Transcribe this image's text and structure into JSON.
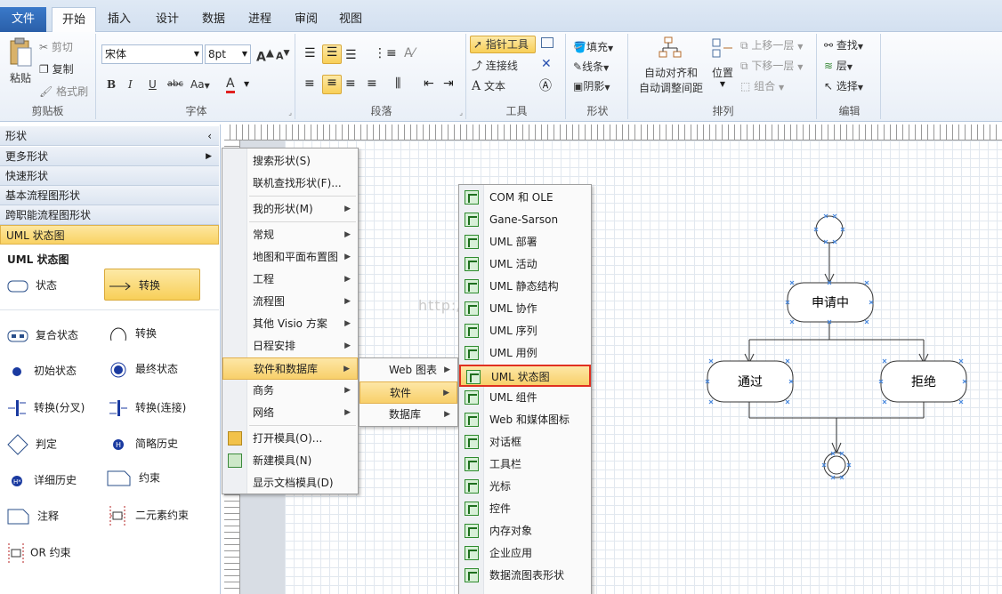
{
  "tabs": [
    "文件",
    "开始",
    "插入",
    "设计",
    "数据",
    "进程",
    "审阅",
    "视图"
  ],
  "ribbon": {
    "clipboard": {
      "paste": "粘贴",
      "cut": "剪切",
      "copy": "复制",
      "format_painter": "格式刷",
      "label": "剪贴板"
    },
    "font": {
      "family": "宋体",
      "size": "8pt",
      "bold": "B",
      "italic": "I",
      "underline": "U",
      "strike": "abc",
      "case": "Aa",
      "color": "A",
      "grow": "A",
      "shrink": "A",
      "label": "字体"
    },
    "paragraph": {
      "label": "段落"
    },
    "tools": {
      "pointer": "指针工具",
      "connector": "连接线",
      "text": "文本",
      "label": "工具"
    },
    "shape": {
      "fill": "填充",
      "line": "线条",
      "shadow": "阴影",
      "label": "形状"
    },
    "arrange": {
      "auto_align": "自动对齐和",
      "auto_space": "自动调整间距",
      "position": "位置",
      "bring_forward": "上移一层",
      "send_backward": "下移一层",
      "group": "组合",
      "label": "排列"
    },
    "editing": {
      "find": "查找",
      "layer": "层",
      "select": "选择",
      "label": "编辑"
    }
  },
  "shapes_panel": {
    "title": "形状",
    "sections": [
      "更多形状",
      "快速形状",
      "基本流程图形状",
      "跨职能流程图形状",
      "UML 状态图"
    ],
    "stencil_title": "UML 状态图",
    "stencils": [
      {
        "label": "状态",
        "icon": "state-icon"
      },
      {
        "label": "转换",
        "icon": "transition-icon"
      },
      {
        "label": "复合状态",
        "icon": "composite-state-icon"
      },
      {
        "label": "转换",
        "icon": "self-transition-icon"
      },
      {
        "label": "初始状态",
        "icon": "initial-state-icon"
      },
      {
        "label": "最终状态",
        "icon": "final-state-icon"
      },
      {
        "label": "转换(分叉)",
        "icon": "fork-icon"
      },
      {
        "label": "转换(连接)",
        "icon": "join-icon"
      },
      {
        "label": "判定",
        "icon": "decision-icon"
      },
      {
        "label": "简略历史",
        "icon": "shallow-history-icon"
      },
      {
        "label": "详细历史",
        "icon": "deep-history-icon"
      },
      {
        "label": "约束",
        "icon": "constraint-icon"
      },
      {
        "label": "注释",
        "icon": "note-icon"
      },
      {
        "label": "二元素约束",
        "icon": "binary-constraint-icon"
      },
      {
        "label": "OR 约束",
        "icon": "or-constraint-icon"
      }
    ]
  },
  "menu1": {
    "items": [
      "搜索形状(S)",
      "联机查找形状(F)...",
      "我的形状(M)",
      "常规",
      "地图和平面布置图",
      "工程",
      "流程图",
      "其他 Visio 方案",
      "日程安排",
      "软件和数据库",
      "商务",
      "网络",
      "打开模具(O)...",
      "新建模具(N)",
      "显示文档模具(D)"
    ]
  },
  "menu2": {
    "items": [
      "Web 图表",
      "软件",
      "数据库"
    ]
  },
  "menu3": {
    "items": [
      "COM 和 OLE",
      "Gane-Sarson",
      "UML 部署",
      "UML 活动",
      "UML 静态结构",
      "UML 协作",
      "UML 序列",
      "UML 用例",
      "UML 状态图",
      "UML 组件",
      "Web 和媒体图标",
      "对话框",
      "工具栏",
      "光标",
      "控件",
      "内存对象",
      "企业应用",
      "数据流图表形状"
    ]
  },
  "diagram": {
    "state1": "申请中",
    "state2": "通过",
    "state3": "拒绝"
  },
  "watermark": "http://blog.csdn.net/"
}
